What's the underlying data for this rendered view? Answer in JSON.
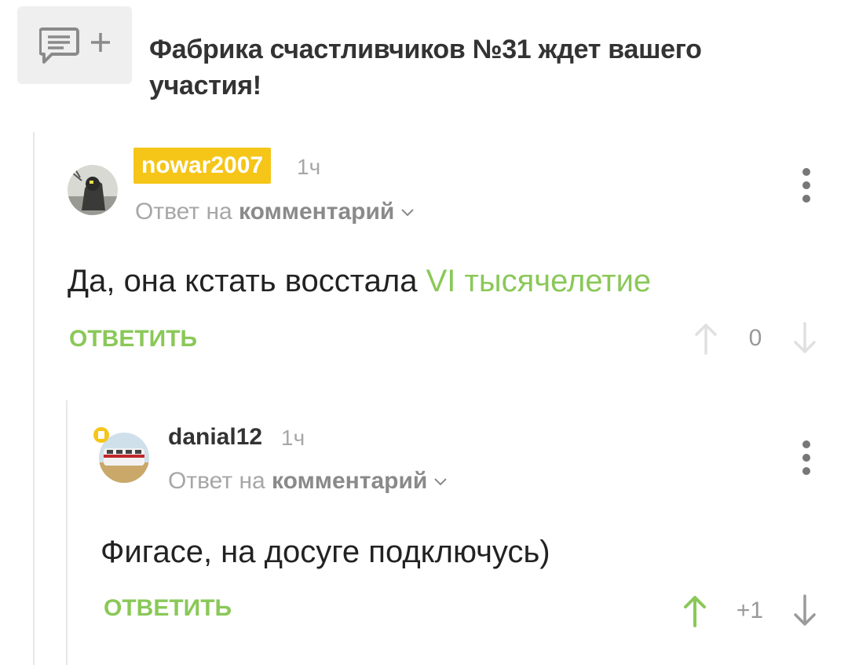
{
  "promo": {
    "icon": "comment-add-icon",
    "title": "Фабрика счастливчиков №31 ждет вашего участия!"
  },
  "comments": [
    {
      "author": "nowar2007",
      "author_badge_color": "#f5c518",
      "time": "1ч",
      "reply_prefix": "Ответ на",
      "reply_target": "комментарий",
      "text_plain": "Да, она кстать восстала ",
      "text_link": "VI тысячелетие",
      "reply_label": "ОТВЕТИТЬ",
      "score": "0",
      "upvoted": false
    },
    {
      "author": "danial12",
      "time": "1ч",
      "reply_prefix": "Ответ на",
      "reply_target": "комментарий",
      "text_plain": "Фигасе, на досуге подключусь)",
      "reply_label": "ОТВЕТИТЬ",
      "score": "+1",
      "upvoted": true
    }
  ],
  "colors": {
    "accent_green": "#8ac858",
    "muted_gray": "#a7a7a7",
    "badge_yellow": "#f5c518"
  }
}
